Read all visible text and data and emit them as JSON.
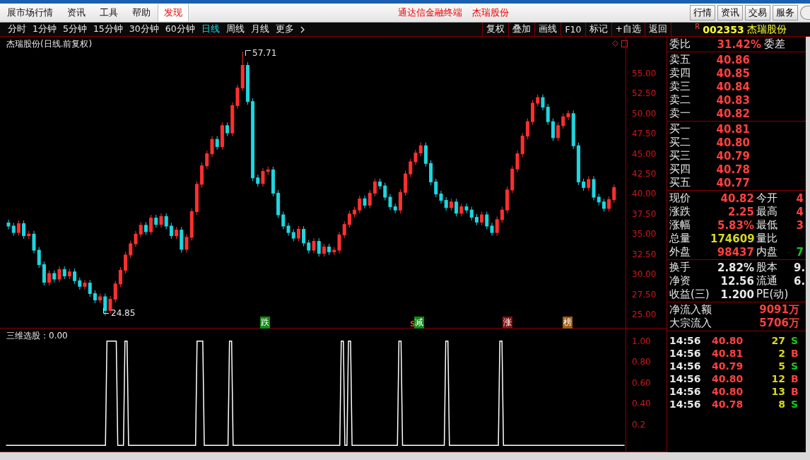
{
  "menu_bar": {
    "items": [
      {
        "label": "展市场行情",
        "selected": false
      },
      {
        "label": "资讯",
        "selected": false
      },
      {
        "label": "工具",
        "selected": false
      },
      {
        "label": "帮助",
        "selected": false
      },
      {
        "label": "发现",
        "selected": true
      }
    ],
    "app_title": "通达信金融终端",
    "stock_title": "杰瑞股份",
    "buttons": [
      "行情",
      "资讯",
      "交易",
      "服务"
    ]
  },
  "period_bar": {
    "periods": [
      {
        "label": "分时",
        "selected": false
      },
      {
        "label": "1分钟",
        "selected": false
      },
      {
        "label": "5分钟",
        "selected": false
      },
      {
        "label": "15分钟",
        "selected": false
      },
      {
        "label": "30分钟",
        "selected": false
      },
      {
        "label": "60分钟",
        "selected": false
      },
      {
        "label": "日线",
        "selected": true
      },
      {
        "label": "周线",
        "selected": false
      },
      {
        "label": "月线",
        "selected": false
      },
      {
        "label": "更多",
        "selected": false
      }
    ],
    "tools": [
      "复权",
      "叠加",
      "画线",
      "F10",
      "标记",
      "+自选",
      "返回"
    ]
  },
  "chart": {
    "title": "杰瑞股份(日线.前复权)",
    "high_label": "57.71",
    "low_label": "24.85",
    "signals": [
      {
        "label": "跌",
        "color": "#108a10"
      },
      {
        "label": "减",
        "color": "#108a10",
        "tag": "S"
      },
      {
        "label": "涨",
        "color": "#8a1010"
      },
      {
        "label": "榜",
        "color": "#a05a10"
      }
    ],
    "chart_data": {
      "type": "candlestick",
      "ylim": [
        23.33,
        59.57
      ],
      "yticks": [
        {
          "value": 55,
          "label": "55.00"
        },
        {
          "value": 52.5,
          "label": "52.50"
        },
        {
          "value": 50,
          "label": "50.00"
        },
        {
          "value": 47.5,
          "label": "47.50"
        },
        {
          "value": 45,
          "label": "45.00"
        },
        {
          "value": 42.5,
          "label": "42.50"
        },
        {
          "value": 40,
          "label": "40.00"
        },
        {
          "value": 37.5,
          "label": "37.50"
        },
        {
          "value": 35,
          "label": "35.00"
        },
        {
          "value": 32.5,
          "label": "32.50"
        },
        {
          "value": 30,
          "label": "30.00"
        },
        {
          "value": 27.5,
          "label": "27.50"
        },
        {
          "value": 25,
          "label": "25.00"
        }
      ],
      "ohlc": [
        [
          36.4,
          36.8,
          35.6,
          36.0
        ],
        [
          36.0,
          36.4,
          34.8,
          35.2
        ],
        [
          35.2,
          36.7,
          34.8,
          36.3
        ],
        [
          36.3,
          36.7,
          34.4,
          34.8
        ],
        [
          34.8,
          35.4,
          34.4,
          35.0
        ],
        [
          35.0,
          35.4,
          32.6,
          33.0
        ],
        [
          33.0,
          33.4,
          30.8,
          31.2
        ],
        [
          31.2,
          31.6,
          28.6,
          29.0
        ],
        [
          29.0,
          30.5,
          28.6,
          30.1
        ],
        [
          30.1,
          30.5,
          29.0,
          29.4
        ],
        [
          29.4,
          31.0,
          29.0,
          30.6
        ],
        [
          30.6,
          31.0,
          29.4,
          29.8
        ],
        [
          29.8,
          30.7,
          29.4,
          30.3
        ],
        [
          30.3,
          30.7,
          28.8,
          29.2
        ],
        [
          29.2,
          29.6,
          28.1,
          28.5
        ],
        [
          28.5,
          29.3,
          28.1,
          28.9
        ],
        [
          28.9,
          29.3,
          27.2,
          27.6
        ],
        [
          27.6,
          28.0,
          26.4,
          26.8
        ],
        [
          26.8,
          27.6,
          26.4,
          27.2
        ],
        [
          27.2,
          27.6,
          24.85,
          25.5
        ],
        [
          25.5,
          27.3,
          25.1,
          26.9
        ],
        [
          26.9,
          29.2,
          26.5,
          28.8
        ],
        [
          28.8,
          30.9,
          28.4,
          30.5
        ],
        [
          30.5,
          32.8,
          30.1,
          32.4
        ],
        [
          32.4,
          34.2,
          32.0,
          33.8
        ],
        [
          33.8,
          35.4,
          33.4,
          35.0
        ],
        [
          35.0,
          36.5,
          34.6,
          36.1
        ],
        [
          36.1,
          36.5,
          34.9,
          35.3
        ],
        [
          35.3,
          37.4,
          34.9,
          37.0
        ],
        [
          37.0,
          37.4,
          35.8,
          36.2
        ],
        [
          36.2,
          37.6,
          35.8,
          37.2
        ],
        [
          37.2,
          37.6,
          35.6,
          36.0
        ],
        [
          36.0,
          36.4,
          34.4,
          34.8
        ],
        [
          34.8,
          35.9,
          34.4,
          35.5
        ],
        [
          35.5,
          35.9,
          32.7,
          33.1
        ],
        [
          33.1,
          35.0,
          32.7,
          34.6
        ],
        [
          34.6,
          38.2,
          34.2,
          37.8
        ],
        [
          37.8,
          41.6,
          37.4,
          41.2
        ],
        [
          41.2,
          43.9,
          40.8,
          43.5
        ],
        [
          43.5,
          45.4,
          43.1,
          45.0
        ],
        [
          45.0,
          47.2,
          44.6,
          46.8
        ],
        [
          46.8,
          47.2,
          45.5,
          45.9
        ],
        [
          45.9,
          48.9,
          45.5,
          48.5
        ],
        [
          48.5,
          48.9,
          47.2,
          47.6
        ],
        [
          47.6,
          51.4,
          47.2,
          51.0
        ],
        [
          51.0,
          53.6,
          50.6,
          53.2
        ],
        [
          53.2,
          57.71,
          52.8,
          56.0
        ],
        [
          56.0,
          56.4,
          51.1,
          51.5
        ],
        [
          51.5,
          51.9,
          41.6,
          42.0
        ],
        [
          42.0,
          42.4,
          40.9,
          41.3
        ],
        [
          41.3,
          43.2,
          40.9,
          42.8
        ],
        [
          42.8,
          43.4,
          42.4,
          43.0
        ],
        [
          43.0,
          43.4,
          39.7,
          40.1
        ],
        [
          40.1,
          40.5,
          37.0,
          37.4
        ],
        [
          37.4,
          37.8,
          35.6,
          36.0
        ],
        [
          36.0,
          36.4,
          34.8,
          35.2
        ],
        [
          35.2,
          35.6,
          34.1,
          34.5
        ],
        [
          34.5,
          36.0,
          34.1,
          35.6
        ],
        [
          35.6,
          36.0,
          33.5,
          33.9
        ],
        [
          33.9,
          34.3,
          32.6,
          33.0
        ],
        [
          33.0,
          34.5,
          32.6,
          34.1
        ],
        [
          34.1,
          34.5,
          32.2,
          32.6
        ],
        [
          32.6,
          33.8,
          32.2,
          33.4
        ],
        [
          33.4,
          33.8,
          32.4,
          32.8
        ],
        [
          32.8,
          33.4,
          32.4,
          33.0
        ],
        [
          33.0,
          35.3,
          32.6,
          34.9
        ],
        [
          34.9,
          36.6,
          34.5,
          36.2
        ],
        [
          36.2,
          37.9,
          35.8,
          37.5
        ],
        [
          37.5,
          38.4,
          37.1,
          38.0
        ],
        [
          38.0,
          39.8,
          37.6,
          39.4
        ],
        [
          39.4,
          39.8,
          38.2,
          38.6
        ],
        [
          38.6,
          40.5,
          38.2,
          40.1
        ],
        [
          40.1,
          41.9,
          39.7,
          41.5
        ],
        [
          41.5,
          41.9,
          40.6,
          41.0
        ],
        [
          41.0,
          41.4,
          39.2,
          39.6
        ],
        [
          39.6,
          40.0,
          38.0,
          38.4
        ],
        [
          38.4,
          38.8,
          37.6,
          38.0
        ],
        [
          38.0,
          40.6,
          37.6,
          40.2
        ],
        [
          40.2,
          42.9,
          39.8,
          42.5
        ],
        [
          42.5,
          44.4,
          42.1,
          44.0
        ],
        [
          44.0,
          45.5,
          43.6,
          45.1
        ],
        [
          45.1,
          46.4,
          44.7,
          46.0
        ],
        [
          46.0,
          46.4,
          43.4,
          43.8
        ],
        [
          43.8,
          44.2,
          41.1,
          41.5
        ],
        [
          41.5,
          41.9,
          39.6,
          40.0
        ],
        [
          40.0,
          40.4,
          38.8,
          39.2
        ],
        [
          39.2,
          39.6,
          37.9,
          38.3
        ],
        [
          38.3,
          39.4,
          37.9,
          39.0
        ],
        [
          39.0,
          39.4,
          37.2,
          37.6
        ],
        [
          37.6,
          38.8,
          37.2,
          38.4
        ],
        [
          38.4,
          38.8,
          37.6,
          38.0
        ],
        [
          38.0,
          38.4,
          36.7,
          37.1
        ],
        [
          37.1,
          37.5,
          36.1,
          36.5
        ],
        [
          36.5,
          37.8,
          36.1,
          37.4
        ],
        [
          37.4,
          37.8,
          35.6,
          36.0
        ],
        [
          36.0,
          36.4,
          34.8,
          35.2
        ],
        [
          35.2,
          37.2,
          34.8,
          36.8
        ],
        [
          36.8,
          38.4,
          36.4,
          38.0
        ],
        [
          38.0,
          40.9,
          37.6,
          40.5
        ],
        [
          40.5,
          43.5,
          40.1,
          43.1
        ],
        [
          43.1,
          45.4,
          42.7,
          45.0
        ],
        [
          45.0,
          47.6,
          44.6,
          47.2
        ],
        [
          47.2,
          49.4,
          46.8,
          49.0
        ],
        [
          49.0,
          51.7,
          48.6,
          51.3
        ],
        [
          51.3,
          52.4,
          50.9,
          52.0
        ],
        [
          52.0,
          52.4,
          50.4,
          50.8
        ],
        [
          50.8,
          51.2,
          48.6,
          49.0
        ],
        [
          49.0,
          49.4,
          46.6,
          47.0
        ],
        [
          47.0,
          48.9,
          46.6,
          48.5
        ],
        [
          48.5,
          50.0,
          48.1,
          49.6
        ],
        [
          49.6,
          50.4,
          49.2,
          50.0
        ],
        [
          50.0,
          50.4,
          45.6,
          46.0
        ],
        [
          46.0,
          46.4,
          41.1,
          41.5
        ],
        [
          41.5,
          41.9,
          40.4,
          40.8
        ],
        [
          40.8,
          42.2,
          40.4,
          41.8
        ],
        [
          41.8,
          42.2,
          39.2,
          39.6
        ],
        [
          39.6,
          40.0,
          38.6,
          39.0
        ],
        [
          39.0,
          39.4,
          37.8,
          38.2
        ],
        [
          38.2,
          39.7,
          37.8,
          39.3
        ],
        [
          39.3,
          41.2,
          38.9,
          40.8
        ]
      ]
    }
  },
  "indicator": {
    "value": "：0.00",
    "chart_data": {
      "type": "line",
      "ylim": [
        -0.06,
        1.12
      ],
      "yticks": [
        {
          "value": 1,
          "label": "1.00"
        },
        {
          "value": 0.8,
          "label": "0.80"
        },
        {
          "value": 0.6,
          "label": "0.60"
        },
        {
          "value": 0.4,
          "label": "0.40"
        },
        {
          "value": 0.2,
          "label": "0.2"
        }
      ],
      "series": [
        {
          "name": "三维选股",
          "color": "#ffffff",
          "values": [
            0,
            0,
            0,
            0,
            0,
            0,
            0,
            0,
            0,
            0,
            0,
            0,
            0,
            0,
            0,
            0,
            0,
            0,
            0,
            0,
            0,
            0,
            0,
            0,
            0,
            0,
            0,
            0,
            1,
            1,
            1,
            0,
            0,
            1,
            0,
            0,
            0,
            0,
            0,
            0,
            0,
            0,
            0,
            0,
            0,
            0,
            0,
            0,
            0,
            0,
            0,
            0,
            0,
            1,
            1,
            0,
            0,
            0,
            0,
            0,
            0,
            0,
            1,
            0,
            0,
            0,
            0,
            0,
            0,
            0,
            0,
            0,
            0,
            0,
            0,
            0,
            0,
            0,
            0,
            0,
            0,
            0,
            0,
            0,
            0,
            0,
            0,
            0,
            0,
            0,
            0,
            0,
            0,
            1,
            0,
            1,
            0,
            0,
            0,
            0,
            0,
            0,
            0,
            0,
            0,
            0,
            0,
            0,
            0,
            1,
            0,
            0,
            0,
            0,
            0,
            0,
            0,
            0,
            0,
            0,
            0,
            0,
            1,
            0,
            0,
            0,
            0,
            0,
            0,
            0,
            0,
            0,
            0,
            0,
            0,
            0,
            0,
            1,
            0,
            0,
            0,
            0,
            0,
            0,
            0,
            0,
            0,
            0,
            0,
            0,
            0,
            0,
            0,
            0,
            0,
            0,
            0,
            0,
            0,
            0,
            0,
            0,
            0,
            0,
            0,
            0,
            0,
            0,
            0,
            0,
            0,
            0
          ]
        }
      ]
    }
  },
  "quote_panel": {
    "flag": "R",
    "code": "002353",
    "name": "杰瑞股份",
    "ratio": {
      "label": "委比",
      "value": "31.42%",
      "label2": "委差"
    },
    "asks": [
      {
        "label": "卖五",
        "price": "40.86"
      },
      {
        "label": "卖四",
        "price": "40.85"
      },
      {
        "label": "卖三",
        "price": "40.84"
      },
      {
        "label": "卖二",
        "price": "40.83"
      },
      {
        "label": "卖一",
        "price": "40.82"
      }
    ],
    "bids": [
      {
        "label": "买一",
        "price": "40.81"
      },
      {
        "label": "买二",
        "price": "40.80"
      },
      {
        "label": "买三",
        "price": "40.79"
      },
      {
        "label": "买四",
        "price": "40.78"
      },
      {
        "label": "买五",
        "price": "40.77"
      }
    ],
    "stats": [
      {
        "left": {
          "label": "现价",
          "value": "40.82",
          "color": "#ff4040"
        },
        "right": {
          "label": "今开",
          "value": "4",
          "color": "#ff4040"
        }
      },
      {
        "left": {
          "label": "涨跌",
          "value": "2.25",
          "color": "#ff4040"
        },
        "right": {
          "label": "最高",
          "value": "4",
          "color": "#ff4040"
        }
      },
      {
        "left": {
          "label": "涨幅",
          "value": "5.83%",
          "color": "#ff4040"
        },
        "right": {
          "label": "最低",
          "value": "3",
          "color": "#ff4040"
        }
      },
      {
        "left": {
          "label": "总量",
          "value": "174609",
          "color": "#d8d820"
        },
        "right": {
          "label": "量比"
        }
      },
      {
        "left": {
          "label": "外盘",
          "value": "98437",
          "color": "#ff4040"
        },
        "right": {
          "label": "内盘",
          "value": "7",
          "color": "#18c818"
        }
      }
    ],
    "finance": [
      {
        "left": {
          "label": "换手",
          "value": "2.82%"
        },
        "right": {
          "label": "股本",
          "value": "9."
        }
      },
      {
        "left": {
          "label": "净资",
          "value": "12.56"
        },
        "right": {
          "label": "流通",
          "value": "6."
        }
      },
      {
        "left": {
          "label": "收益(三)",
          "value": "1.200"
        },
        "right": {
          "label": "PE(动)"
        }
      }
    ],
    "flows": [
      {
        "label": "净流入额",
        "value": "9091万"
      },
      {
        "label": "大宗流入",
        "value": "5706万"
      }
    ],
    "trades": [
      {
        "time": "14:56",
        "price": "40.80",
        "volume": "27",
        "flag": "S",
        "buy": false
      },
      {
        "time": "14:56",
        "price": "40.81",
        "volume": "2",
        "flag": "B",
        "buy": true
      },
      {
        "time": "14:56",
        "price": "40.79",
        "volume": "5",
        "flag": "S",
        "buy": false
      },
      {
        "time": "14:56",
        "price": "40.80",
        "volume": "12",
        "flag": "B",
        "buy": true
      },
      {
        "time": "14:56",
        "price": "40.80",
        "volume": "13",
        "flag": "B",
        "buy": true
      },
      {
        "time": "14:56",
        "price": "40.78",
        "volume": "8",
        "flag": "S",
        "buy": false
      }
    ]
  }
}
